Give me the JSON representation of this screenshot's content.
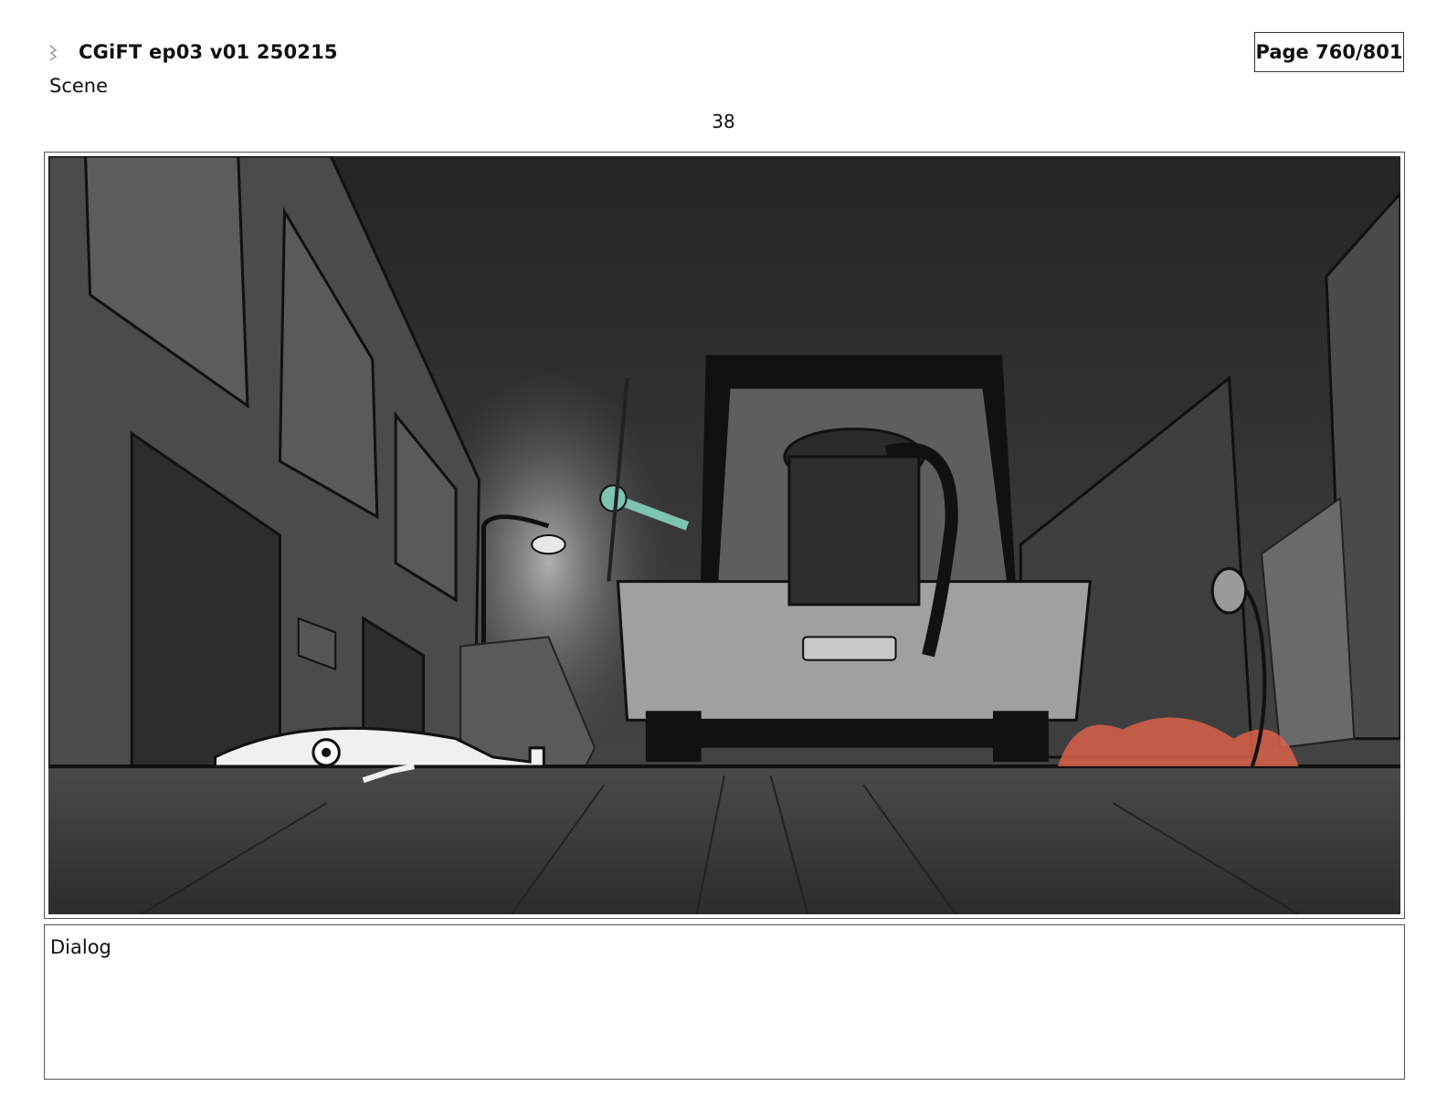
{
  "header": {
    "title": "CGiFT ep03 v01 250215",
    "scene_label": "Scene",
    "page_label": "Page 760/801",
    "icon": "flag-icon"
  },
  "panel": {
    "number": "38",
    "image_description_icon": "storyboard-panel-image"
  },
  "dialog": {
    "label": "Dialog",
    "text": ""
  },
  "colors": {
    "frame_border": "#555555",
    "sky": "#2a2a2a",
    "ground": "#3a3a3a",
    "building": "#444444",
    "glove_teal": "#7fc4b0",
    "splash_red": "#d9604a"
  }
}
